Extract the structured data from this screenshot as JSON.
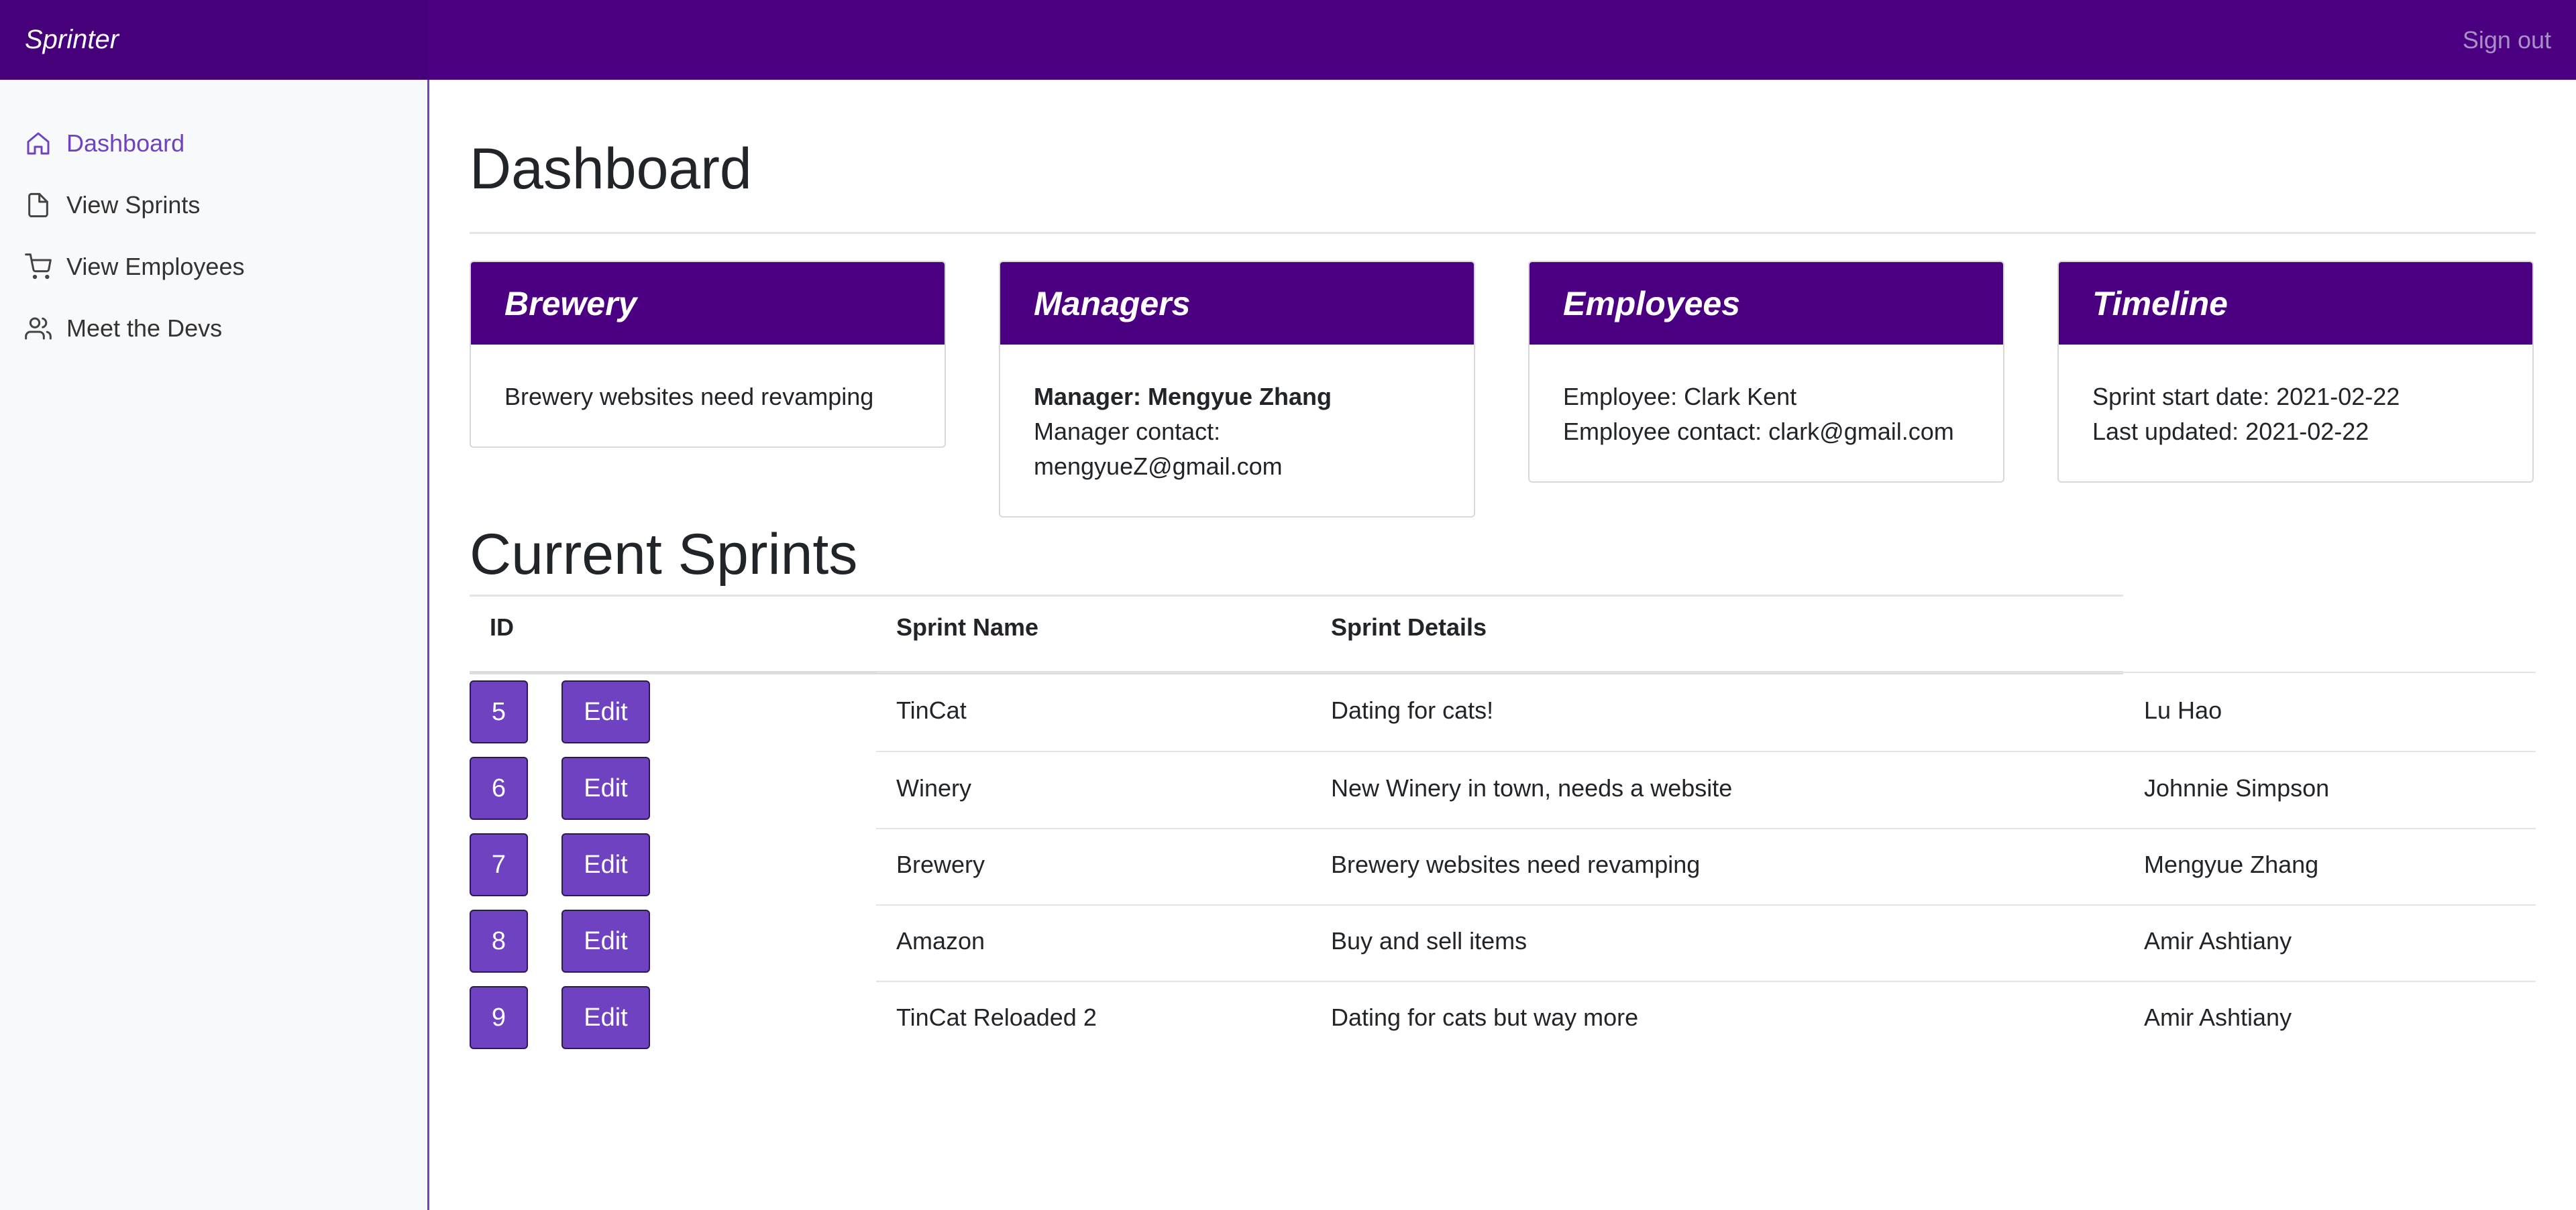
{
  "app": {
    "brand": "Sprinter",
    "sign_out": "Sign out"
  },
  "sidebar": {
    "items": [
      {
        "label": "Dashboard",
        "icon": "home-icon",
        "active": true
      },
      {
        "label": "View Sprints",
        "icon": "file-icon",
        "active": false
      },
      {
        "label": "View Employees",
        "icon": "cart-icon",
        "active": false
      },
      {
        "label": "Meet the Devs",
        "icon": "users-icon",
        "active": false
      }
    ]
  },
  "main": {
    "title": "Dashboard",
    "cards": [
      {
        "title": "Brewery",
        "line1": "Brewery websites need revamping"
      },
      {
        "title": "Managers",
        "strong": "Manager: Mengyue Zhang",
        "line2": "Manager contact:",
        "line3": "mengyueZ@gmail.com"
      },
      {
        "title": "Employees",
        "line1": "Employee: Clark Kent",
        "line2": "Employee contact: clark@gmail.com"
      },
      {
        "title": "Timeline",
        "line1": "Sprint start date: 2021-02-22",
        "line2": "Last updated: 2021-02-22"
      }
    ],
    "sprints": {
      "title": "Current Sprints",
      "headers": {
        "id": "ID",
        "name": "Sprint Name",
        "details": "Sprint Details"
      },
      "edit_label": "Edit",
      "rows": [
        {
          "id": "5",
          "name": "TinCat",
          "details": "Dating for cats!",
          "owner": "Lu Hao"
        },
        {
          "id": "6",
          "name": "Winery",
          "details": "New Winery in town, needs a website",
          "owner": "Johnnie Simpson"
        },
        {
          "id": "7",
          "name": "Brewery",
          "details": "Brewery websites need revamping",
          "owner": "Mengyue Zhang"
        },
        {
          "id": "8",
          "name": "Amazon",
          "details": "Buy and sell items",
          "owner": "Amir Ashtiany"
        },
        {
          "id": "9",
          "name": "TinCat Reloaded 2",
          "details": "Dating for cats but way more",
          "owner": "Amir Ashtiany"
        }
      ]
    }
  },
  "colors": {
    "accent": "#6f42c1",
    "header": "#4b0082",
    "sidebar_bg": "#f8f9fb"
  }
}
